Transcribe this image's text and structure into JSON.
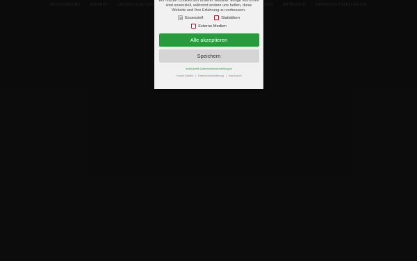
{
  "nav": {
    "left_items": [
      "Reservierung",
      "Anfahrt",
      "Speisen & Getränke"
    ],
    "right_items": [
      "...eiten",
      "Impressum",
      "Datenschutzerklärung"
    ]
  },
  "cookie": {
    "intro": "Wir nutzen Cookies auf unserer Website. Einige von ihnen sind essenziell, während andere uns helfen, diese Website und Ihre Erfahrung zu verbessern.",
    "options": [
      {
        "label": "Essenziell",
        "checked": true
      },
      {
        "label": "Statistiken",
        "checked": false
      },
      {
        "label": "Externe Medien",
        "checked": false
      }
    ],
    "accept_label": "Alle akzeptieren",
    "save_label": "Speichern",
    "individual_settings": "Individuelle Datenschutzeinstellungen",
    "footer": [
      "Cookie-Details",
      "Datenschutzerklärung",
      "Impressum"
    ]
  },
  "colors": {
    "accent": "#2a9a3f",
    "background": "#121212",
    "dialog": "#f1f1f1"
  }
}
